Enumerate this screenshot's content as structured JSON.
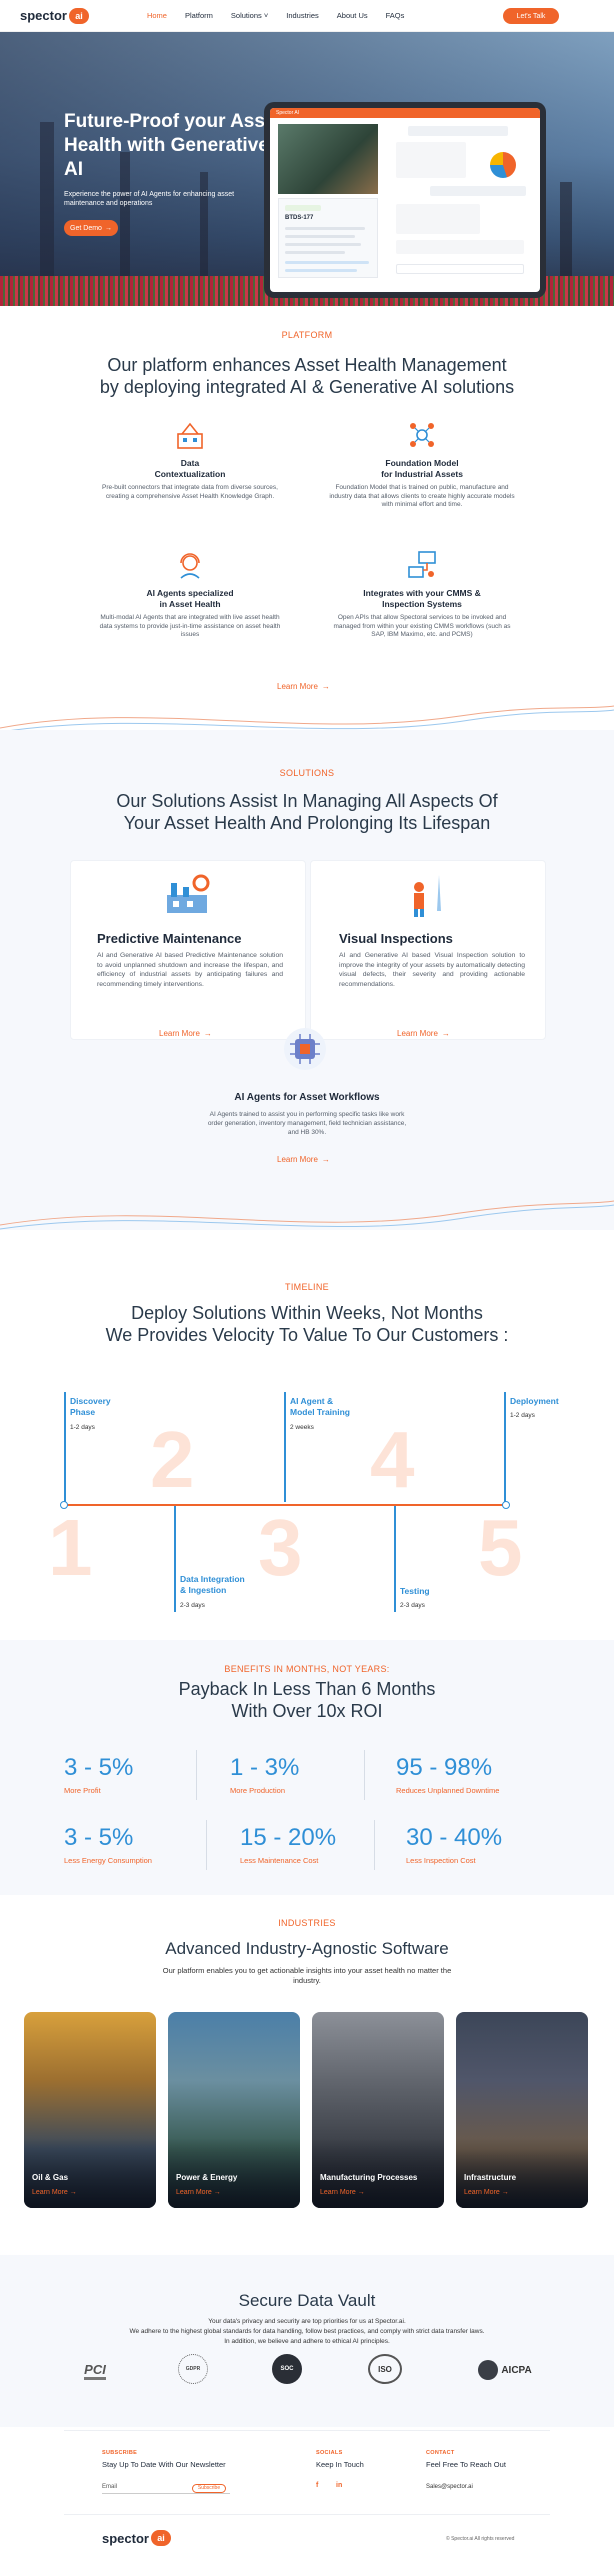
{
  "header": {
    "logo_text": "spector",
    "logo_badge": "ai",
    "nav": [
      {
        "label": "Home",
        "active": true
      },
      {
        "label": "Platform",
        "active": false
      },
      {
        "label": "Solutions ˅",
        "active": false
      },
      {
        "label": "Industries",
        "active": false
      },
      {
        "label": "About Us",
        "active": false
      },
      {
        "label": "FAQs",
        "active": false
      }
    ],
    "cta": "Let's Talk"
  },
  "hero": {
    "title": "Future-Proof your Asset Health with Generative AI",
    "subtitle": "Experience the power of AI Agents for enhancing asset maintenance and operations",
    "button": "Get Demo",
    "tablet_header": "Spector AI",
    "tablet_asset_id": "BTDS-177"
  },
  "platform": {
    "tag": "PLATFORM",
    "title_line1": "Our platform enhances Asset Health Management",
    "title_line2": "by deploying integrated AI & Generative AI solutions",
    "features": [
      {
        "title_line1": "Data",
        "title_line2": "Contextualization",
        "desc": "Pre-built connectors that integrate data from diverse sources, creating a comprehensive Asset Health Knowledge Graph.",
        "icon": "factory-icon"
      },
      {
        "title_line1": "Foundation Model",
        "title_line2": "for Industrial Assets",
        "desc": "Foundation Model that is trained on public, manufacture and industry data that allows clients to create highly accurate models with minimal effort and time.",
        "icon": "network-icon"
      },
      {
        "title_line1": "AI Agents specialized",
        "title_line2": "in Asset Health",
        "desc": "Multi-modal AI Agents that are integrated with live asset health data systems to provide just-in-time assistance on asset health issues",
        "icon": "headset-agent-icon"
      },
      {
        "title_line1": "Integrates with your CMMS &",
        "title_line2": "Inspection Systems",
        "desc": "Open APIs that allow Spectoral services to be invoked and managed from within your existing CMMS workflows (such as SAP, IBM Maximo, etc. and PCMS)",
        "icon": "integration-icon"
      }
    ],
    "learn_more": "Learn More"
  },
  "solutions": {
    "tag": "SOLUTIONS",
    "title_line1": "Our Solutions Assist In Managing All Aspects Of",
    "title_line2": "Your Asset Health And Prolonging Its Lifespan",
    "cards": [
      {
        "title": "Predictive Maintenance",
        "desc": "AI and Generative AI based Predictive Maintenance solution to avoid unplanned shutdown and increase the lifespan, and efficiency of industrial assets by anticipating failures and recommending timely interventions.",
        "learn": "Learn More"
      },
      {
        "title": "Visual Inspections",
        "desc": "AI and Generative AI based Visual Inspection solution to improve the integrity of your assets by automatically detecting visual defects, their severity and providing actionable recommendations.",
        "learn": "Learn More"
      },
      {
        "title": "AI Agents for Asset Workflows",
        "desc": "AI Agents trained to assist you in performing specific tasks like work order generation, inventory management, field technician assistance, and HB 30%.",
        "learn": "Learn More"
      }
    ]
  },
  "timeline": {
    "tag": "TIMELINE",
    "title_line1": "Deploy Solutions Within Weeks, Not Months",
    "title_line2": "We Provides Velocity To Value To Our Customers :",
    "steps": [
      {
        "num": "1",
        "label_line1": "Discovery",
        "label_line2": "Phase",
        "duration": "1-2 days"
      },
      {
        "num": "2",
        "label_line1": "Data Integration",
        "label_line2": "& Ingestion",
        "duration": "2-3 days"
      },
      {
        "num": "3",
        "label_line1": "AI Agent &",
        "label_line2": "Model Training",
        "duration": "2 weeks"
      },
      {
        "num": "4",
        "label_line1": "Testing",
        "label_line2": "",
        "duration": "2-3 days"
      },
      {
        "num": "5",
        "label_line1": "Deployment",
        "label_line2": "",
        "duration": "1-2 days"
      }
    ]
  },
  "benefits": {
    "tag": "BENEFITS IN MONTHS, NOT YEARS:",
    "title_line1": "Payback In Less Than 6 Months",
    "title_line2": "With Over 10x ROI",
    "stats": [
      {
        "value": "3 - 5%",
        "label": "More Profit"
      },
      {
        "value": "1 - 3%",
        "label": "More Production"
      },
      {
        "value": "95 - 98%",
        "label": "Reduces Unplanned Downtime"
      },
      {
        "value": "3 - 5%",
        "label": "Less Energy Consumption"
      },
      {
        "value": "15 - 20%",
        "label": "Less Maintenance Cost"
      },
      {
        "value": "30 - 40%",
        "label": "Less Inspection Cost"
      }
    ]
  },
  "industries": {
    "tag": "INDUSTRIES",
    "title": "Advanced Industry-Agnostic Software",
    "subtitle": "Our platform enables you to get actionable insights into your asset health no matter the industry.",
    "cards": [
      {
        "name": "Oil & Gas",
        "learn": "Learn More"
      },
      {
        "name": "Power & Energy",
        "learn": "Learn More"
      },
      {
        "name": "Manufacturing Processes",
        "learn": "Learn More"
      },
      {
        "name": "Infrastructure",
        "learn": "Learn More"
      }
    ]
  },
  "vault": {
    "title": "Secure Data Vault",
    "line1": "Your data's privacy and security are top priorities for us at Spector.ai.",
    "line2": "We adhere to the highest global standards for data handling, follow best practices, and comply with strict data transfer laws.",
    "line3": "In addition, we believe and adhere to ethical AI principles.",
    "certs": [
      "PCI",
      "GDPR",
      "SOC",
      "ISO",
      "AICPA"
    ]
  },
  "footer": {
    "subscribe_tag": "SUBSCRIBE",
    "subscribe_head": "Stay Up To Date With Our Newsletter",
    "email_placeholder": "Email",
    "subscribe_btn": "Subscribe",
    "socials_tag": "SOCIALS",
    "socials_head": "Keep In Touch",
    "social_icons": [
      "facebook-icon",
      "linkedin-icon"
    ],
    "contact_tag": "CONTACT",
    "contact_head": "Feel Free To Reach Out",
    "contact_email": "Sales@spector.ai",
    "logo_text": "spector",
    "logo_badge": "ai",
    "copyright": "© Spector.ai All rights reserved"
  }
}
